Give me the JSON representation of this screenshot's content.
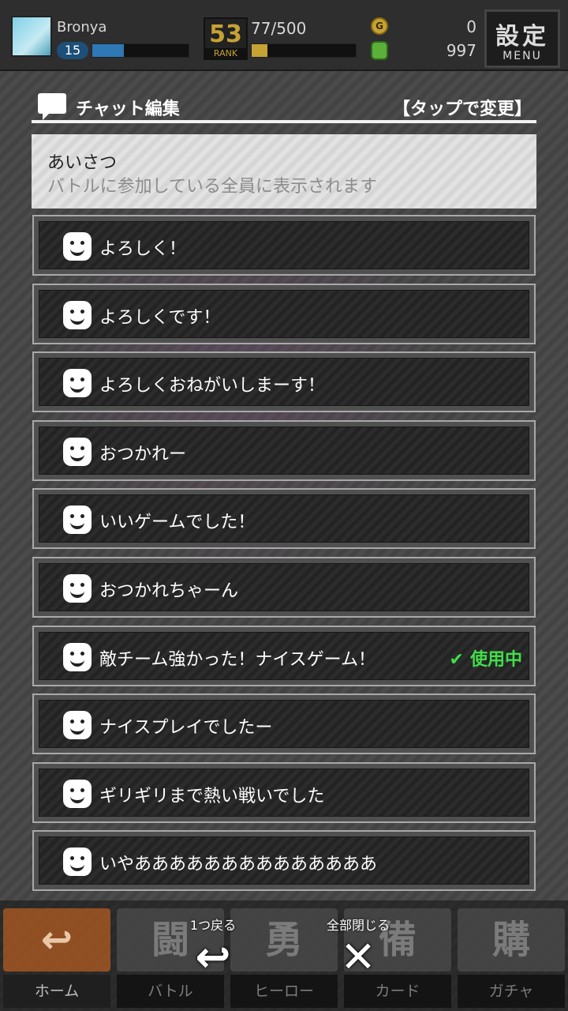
{
  "header": {
    "player_name": "Bronya",
    "level": "15",
    "exp_fraction": 0.33,
    "rank_number": "53",
    "rank_label": "RANK",
    "rank_progress": "77/500",
    "rank_fraction": 0.15,
    "coin_symbol": "G",
    "coin_value": "0",
    "gem_value": "997",
    "menu_kanji": "設定",
    "menu_label": "MENU"
  },
  "panel": {
    "title": "チャット編集",
    "tap_hint": "【タップで変更】",
    "category_title": "あいさつ",
    "category_description": "バトルに参加している全員に表示されます"
  },
  "chat_items": [
    {
      "text": "よろしく！",
      "in_use": false
    },
    {
      "text": "よろしくです！",
      "in_use": false
    },
    {
      "text": "よろしくおねがいしまーす！",
      "in_use": false
    },
    {
      "text": "おつかれー",
      "in_use": false
    },
    {
      "text": "いいゲームでした！",
      "in_use": false
    },
    {
      "text": "おつかれちゃーん",
      "in_use": false
    },
    {
      "text": "敵チーム強かった！ナイスゲーム！",
      "in_use": true
    },
    {
      "text": "ナイスプレイでしたー",
      "in_use": false
    },
    {
      "text": "ギリギリまで熱い戦いでした",
      "in_use": false
    },
    {
      "text": "いやああああああああああああああ",
      "in_use": false
    }
  ],
  "in_use_label": "使用中",
  "check_glyph": "✔",
  "bottom_nav": {
    "tabs": [
      {
        "art": "↩",
        "label": "ホーム"
      },
      {
        "art": "闘",
        "label": "バトル"
      },
      {
        "art": "勇",
        "label": "ヒーロー"
      },
      {
        "art": "備",
        "label": "カード"
      },
      {
        "art": "購",
        "label": "ガチャ"
      }
    ],
    "back_label": "1つ戻る",
    "back_glyph": "↩",
    "close_all_label": "全部閉じる",
    "close_all_glyph": "✕"
  },
  "colors": {
    "in_use_green": "#3fe04a",
    "rank_gold": "#c7a234",
    "exp_blue": "#2d78b5"
  }
}
